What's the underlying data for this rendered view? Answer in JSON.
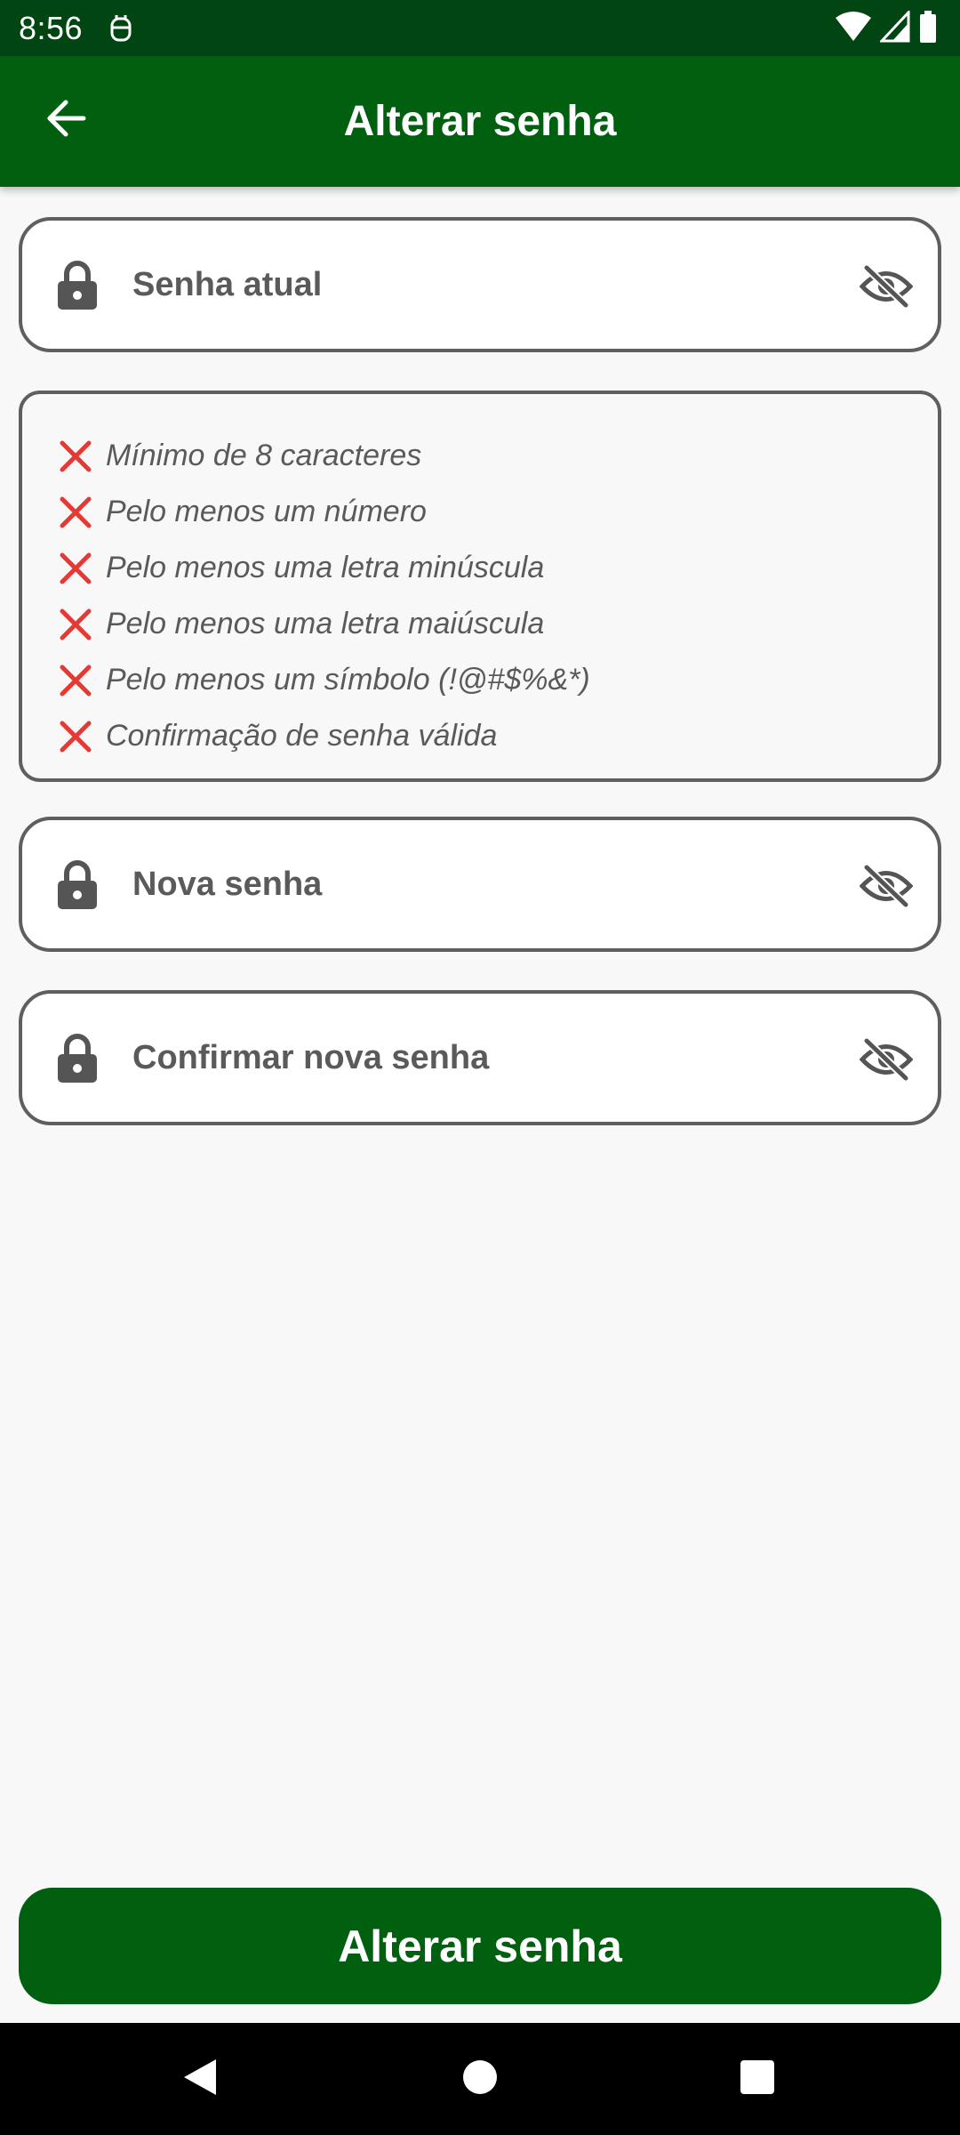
{
  "status_bar": {
    "time": "8:56"
  },
  "app_bar": {
    "title": "Alterar senha"
  },
  "fields": {
    "current_password": {
      "placeholder": "Senha atual",
      "value": ""
    },
    "new_password": {
      "placeholder": "Nova senha",
      "value": ""
    },
    "confirm_password": {
      "placeholder": "Confirmar nova senha",
      "value": ""
    }
  },
  "requirements": {
    "items": [
      {
        "label": "Mínimo de 8 caracteres",
        "met": false
      },
      {
        "label": "Pelo menos um número",
        "met": false
      },
      {
        "label": "Pelo menos uma letra minúscula",
        "met": false
      },
      {
        "label": "Pelo menos uma letra maiúscula",
        "met": false
      },
      {
        "label": "Pelo menos um símbolo (!@#$%&*)",
        "met": false
      },
      {
        "label": "Confirmação de senha válida",
        "met": false
      }
    ]
  },
  "actions": {
    "submit_label": "Alterar senha"
  },
  "colors": {
    "primary": "#00600f",
    "status_bar": "#014512",
    "error": "#e53935",
    "border": "#5f5f5f",
    "background": "#f8f8f8"
  },
  "icons": {
    "back": "arrow-left-icon",
    "lock": "lock-icon",
    "visibility": "visibility-off-icon",
    "requirement_unmet": "close-x-icon"
  }
}
